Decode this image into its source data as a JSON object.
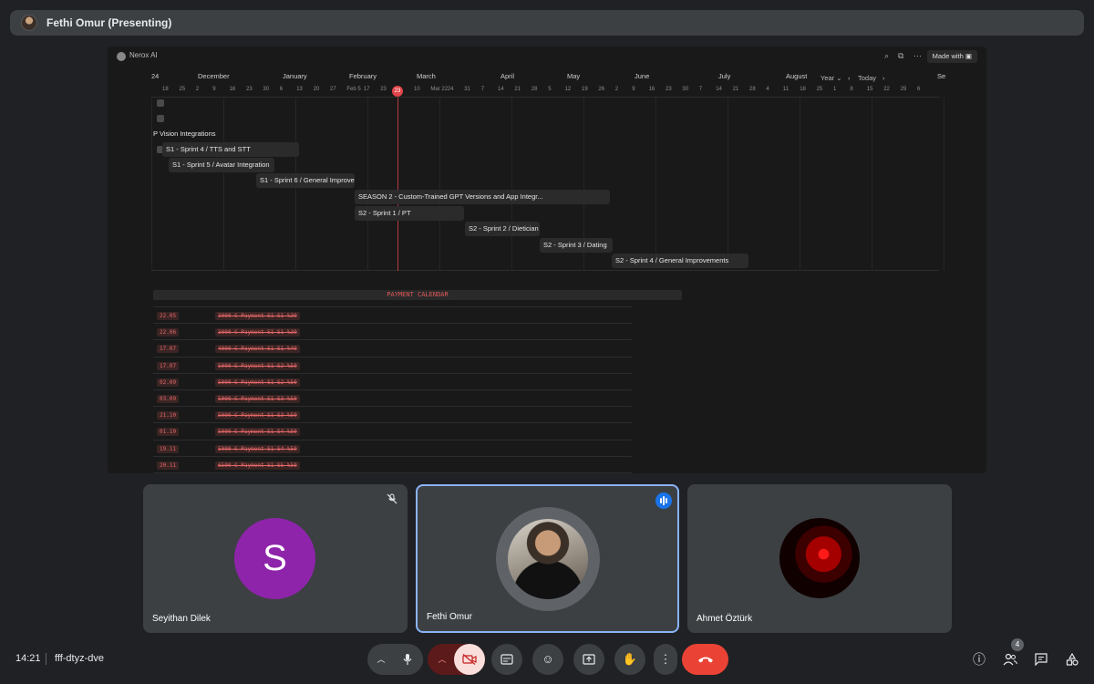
{
  "presenter": {
    "name": "Fethi Omur (Presenting)"
  },
  "shared_screen": {
    "app_name": "Nerox AI",
    "made_with": "Made with",
    "timeline": {
      "year_label": "Year",
      "today_label": "Today",
      "months": [
        "24",
        "December",
        "January",
        "February",
        "March",
        "April",
        "May",
        "June",
        "July",
        "August",
        "Se"
      ],
      "days": [
        "18",
        "25",
        "2",
        "9",
        "16",
        "23",
        "30",
        "6",
        "13",
        "20",
        "27",
        "Feb 5",
        "17",
        "23",
        "3",
        "10",
        "Mar 22",
        "24",
        "31",
        "7",
        "14",
        "21",
        "28",
        "5",
        "12",
        "19",
        "26",
        "2",
        "9",
        "16",
        "23",
        "30",
        "7",
        "14",
        "21",
        "28",
        "4",
        "11",
        "18",
        "25",
        "1",
        "8",
        "15",
        "22",
        "29",
        "6"
      ],
      "today_day": "23",
      "tasks": [
        "P Vision Integrations",
        "S1 - Sprint 4 / TTS and STT",
        "S1 - Sprint 5 / Avatar Integration",
        "S1 - Sprint 6 / General Improvements",
        "SEASON 2 - Custom-Trained GPT Versions and App Integr...",
        "S2 - Sprint 1 / PT",
        "S2 - Sprint 2 / Dietician",
        "S2 - Sprint 3 / Dating",
        "S2 - Sprint 4 / General Improvements"
      ]
    },
    "payment_calendar": {
      "title": "PAYMENT CALENDAR",
      "rows": [
        {
          "date": "22.05",
          "desc": "3000-€ Payment S1-S1 %30"
        },
        {
          "date": "22.06",
          "desc": "3000-€ Payment S1-S1 %30"
        },
        {
          "date": "17.07",
          "desc": "4000-€ Payment S1-S1 %40"
        },
        {
          "date": "17.07",
          "desc": "5000-€ Payment S1-S2 %50"
        },
        {
          "date": "02.09",
          "desc": "5000-€ Payment S1-S2 %50"
        },
        {
          "date": "03.09",
          "desc": "5000-€ Payment S1-S3 %50"
        },
        {
          "date": "21.10",
          "desc": "5000-€ Payment S1-S3 %50"
        },
        {
          "date": "01.10",
          "desc": "5000-€ Payment S1-S4 %50"
        },
        {
          "date": "19.11",
          "desc": "5000-€ Payment S1-S4 %50"
        },
        {
          "date": "20.11",
          "desc": "6500-€ Payment S1-S5 %50"
        }
      ]
    }
  },
  "participants": [
    {
      "name": "Seyithan Dilek",
      "initial": "S",
      "muted": true
    },
    {
      "name": "Fethi Omur",
      "speaking": true
    },
    {
      "name": "Ahmet Öztürk"
    }
  ],
  "meeting": {
    "time": "14:21",
    "code": "fff-dtyz-dve"
  },
  "people_count": "4",
  "colors": {
    "accent": "#8ab4f8",
    "end_call": "#ea4335",
    "avatar_s": "#8e24aa"
  }
}
